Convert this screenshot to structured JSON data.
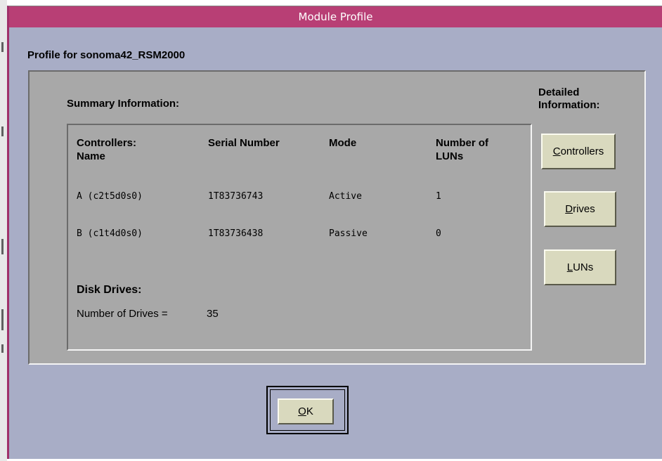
{
  "window": {
    "title": "Module Profile"
  },
  "profile": {
    "label": "Profile for sonoma42_RSM2000"
  },
  "summary": {
    "title": "Summary Information:",
    "headers": {
      "name": "Controllers:\nName",
      "serial": "Serial Number",
      "mode": "Mode",
      "luns": "Number of\nLUNs"
    },
    "rows": [
      {
        "name": "A (c2t5d0s0)",
        "serial": "1T83736743",
        "mode": "Active",
        "luns": "1"
      },
      {
        "name": "B (c1t4d0s0)",
        "serial": "1T83736438",
        "mode": "Passive",
        "luns": "0"
      }
    ],
    "disk_drives": {
      "title": "Disk Drives:",
      "label": "Number of Drives =",
      "value": "35"
    }
  },
  "detailed": {
    "title": "Detailed\nInformation:",
    "buttons": [
      {
        "mnemonic": "C",
        "rest": "ontrollers"
      },
      {
        "mnemonic": "D",
        "rest": "rives"
      },
      {
        "mnemonic": "L",
        "rest": "UNs"
      }
    ]
  },
  "ok_button": {
    "mnemonic": "O",
    "rest": "K"
  }
}
